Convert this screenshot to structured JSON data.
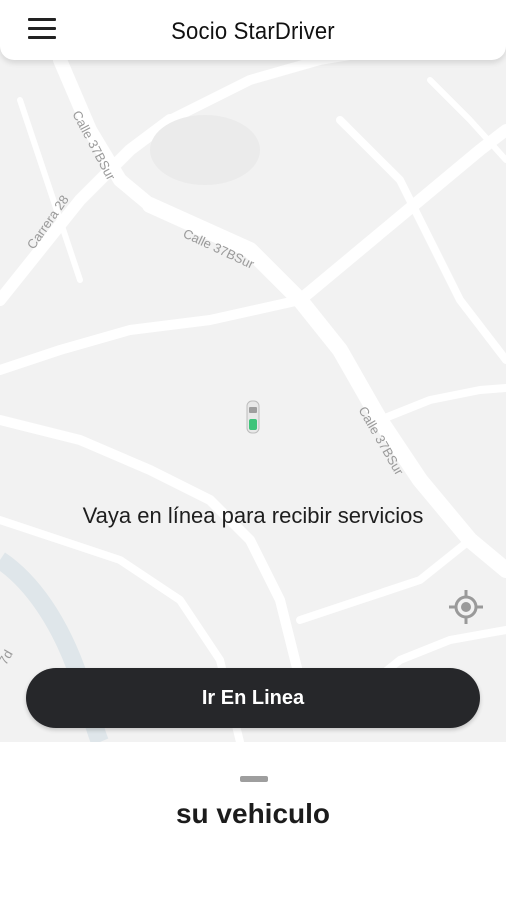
{
  "header": {
    "title": "Socio StarDriver",
    "menu_icon": "hamburger-menu-icon"
  },
  "map": {
    "street_labels": [
      "Calle 37BSur",
      "Carrera 28",
      "Calle 37BSur",
      "Calle 37BSur",
      "7d"
    ],
    "background_color": "#f2f2f2",
    "road_color": "#ffffff",
    "car_icon": "car-marker-icon",
    "gps_icon": "my-location-icon"
  },
  "status": {
    "message": "Vaya en línea para recibir servicios"
  },
  "actions": {
    "go_online_label": "Ir En Linea"
  },
  "bottom_sheet": {
    "title": "su vehiculo"
  },
  "colors": {
    "button_bg": "#26272a",
    "button_text": "#ffffff",
    "car_accent": "#3ec47a"
  }
}
